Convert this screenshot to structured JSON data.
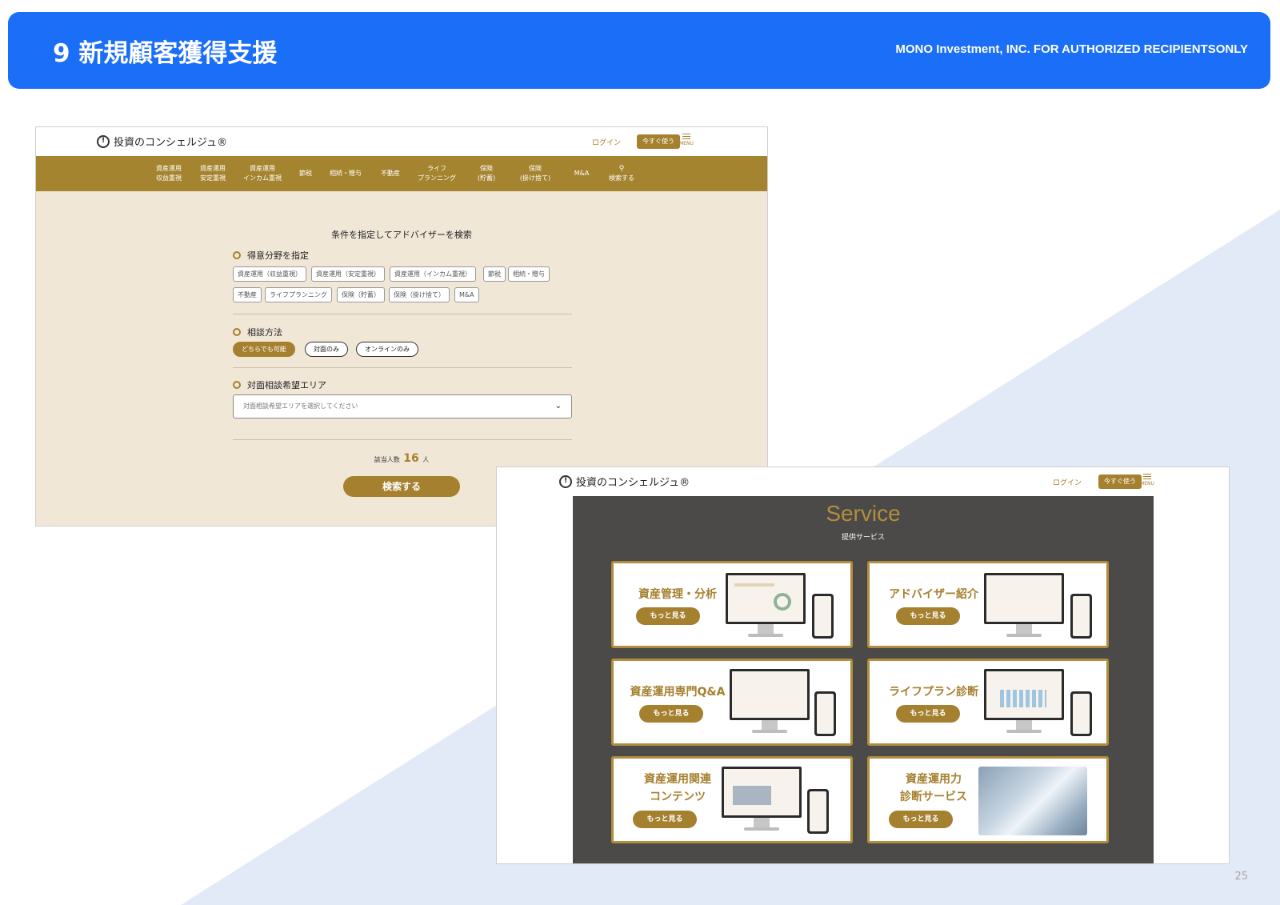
{
  "slide": {
    "title": "9 新規顧客獲得支援",
    "confidential": "MONO Investment, INC. FOR AUTHORIZED RECIPIENTSONLY",
    "page_number": "25"
  },
  "site": {
    "logo_text": "投資のコンシェルジュ®",
    "login": "ログイン",
    "cta": "今すぐ使う",
    "menu": "MENU"
  },
  "search_page": {
    "nav": [
      "資産運用\n収益重視",
      "資産運用\n安定重視",
      "資産運用\nインカム重視",
      "節税",
      "相続・贈与",
      "不動産",
      "ライフ\nプランニング",
      "保険\n(貯蓄)",
      "保険\n(掛け捨て)",
      "M&A",
      "検索する"
    ],
    "heading": "条件を指定してアドバイザーを検索",
    "specialty_label": "得意分野を指定",
    "specialty_chips": [
      "資産運用（収益重視）",
      "資産運用（安定重視）",
      "資産運用（インカム重視）",
      "節税",
      "相続・贈与",
      "不動産",
      "ライフプランニング",
      "保険（貯蓄）",
      "保険（掛け捨て）",
      "M&A"
    ],
    "method_label": "相談方法",
    "method_options": [
      "どちらでも可能",
      "対面のみ",
      "オンラインのみ"
    ],
    "method_selected": "どちらでも可能",
    "area_label": "対面相談希望エリア",
    "area_placeholder": "対面相談希望エリアを選択してください",
    "count_prefix": "該当人数",
    "count_value": "16",
    "count_unit": "人",
    "search_button": "検索する"
  },
  "service_page": {
    "title": "Service",
    "subtitle": "提供サービス",
    "cards": [
      {
        "title": "資産管理・分析",
        "button": "もっと見る"
      },
      {
        "title": "アドバイザー紹介",
        "button": "もっと見る"
      },
      {
        "title": "資産運用専門Q&A",
        "button": "もっと見る"
      },
      {
        "title": "ライフプラン診断",
        "button": "もっと見る"
      },
      {
        "title": "資産運用関連\nコンテンツ",
        "button": "もっと見る"
      },
      {
        "title": "資産運用力\n診断サービス",
        "button": "もっと見る"
      }
    ]
  },
  "colors": {
    "header_blue": "#1a6ef7",
    "gold": "#a5802f",
    "beige": "#f1e7d7",
    "dark_panel": "#4b4a48",
    "triangle": "#e3eaf7"
  }
}
